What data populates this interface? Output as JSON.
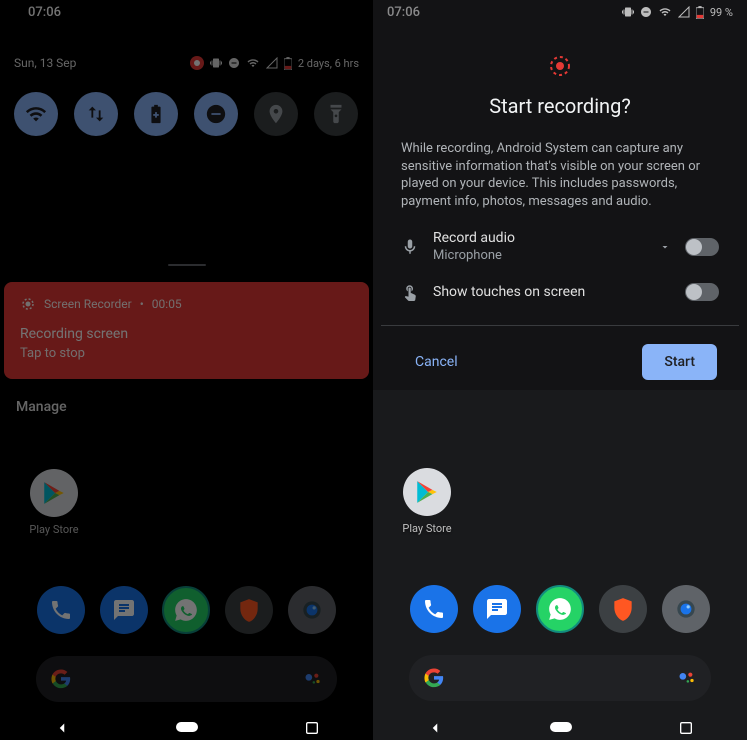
{
  "left": {
    "clock": "07:06",
    "date": "Sun, 13 Sep",
    "battery_estimate": "2 days, 6 hrs",
    "notification": {
      "app": "Screen Recorder",
      "time": "00:05",
      "title": "Recording screen",
      "subtitle": "Tap to stop"
    },
    "manage": "Manage",
    "play_label": "Play Store"
  },
  "right": {
    "clock": "07:06",
    "battery_pct": "99 %",
    "dialog": {
      "title": "Start recording?",
      "body": "While recording, Android System can capture any sensitive information that's visible on your screen or played on your device. This includes passwords, payment info, photos, messages and audio.",
      "audio_label": "Record audio",
      "audio_source": "Microphone",
      "touches_label": "Show touches on screen",
      "cancel": "Cancel",
      "start": "Start"
    },
    "play_label": "Play Store"
  }
}
